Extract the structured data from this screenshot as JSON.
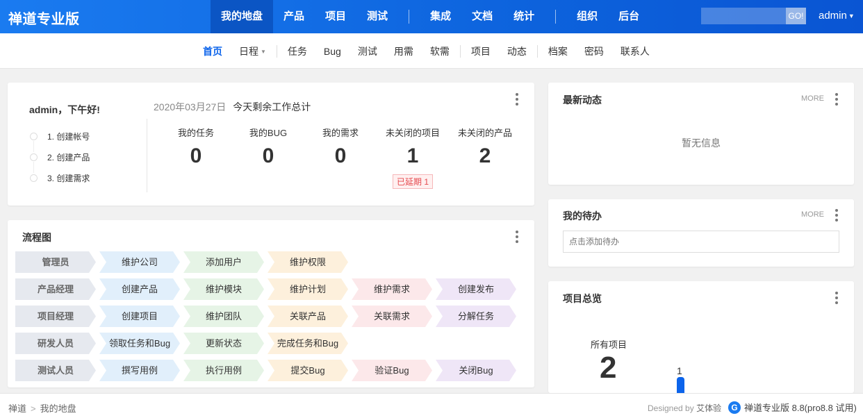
{
  "app": {
    "brand": "禅道专业版"
  },
  "mainnav": {
    "items": [
      "我的地盘",
      "产品",
      "项目",
      "测试",
      "集成",
      "文档",
      "统计",
      "组织",
      "后台"
    ],
    "active": "我的地盘",
    "go_label": "GO!",
    "user": "admin"
  },
  "subnav": {
    "items": [
      "首页",
      "日程",
      "任务",
      "Bug",
      "测试",
      "用需",
      "软需",
      "项目",
      "动态",
      "档案",
      "密码",
      "联系人"
    ],
    "active": "首页"
  },
  "welcome": {
    "greeting": "admin，下午好!",
    "date": "2020年03月27日",
    "summary": "今天剩余工作总计",
    "steps": [
      "1. 创建帐号",
      "2. 创建产品",
      "3. 创建需求"
    ],
    "stats": [
      {
        "label": "我的任务",
        "value": "0"
      },
      {
        "label": "我的BUG",
        "value": "0"
      },
      {
        "label": "我的需求",
        "value": "0"
      },
      {
        "label": "未关闭的项目",
        "value": "1",
        "badge": "已延期 1"
      },
      {
        "label": "未关闭的产品",
        "value": "2"
      }
    ]
  },
  "flow": {
    "title": "流程图",
    "rows": [
      {
        "role": "管理员",
        "steps": [
          "维护公司",
          "添加用户",
          "维护权限"
        ]
      },
      {
        "role": "产品经理",
        "steps": [
          "创建产品",
          "维护模块",
          "维护计划",
          "维护需求",
          "创建发布"
        ]
      },
      {
        "role": "项目经理",
        "steps": [
          "创建项目",
          "维护团队",
          "关联产品",
          "关联需求",
          "分解任务"
        ]
      },
      {
        "role": "研发人员",
        "steps": [
          "领取任务和Bug",
          "更新状态",
          "完成任务和Bug"
        ]
      },
      {
        "role": "测试人员",
        "steps": [
          "撰写用例",
          "执行用例",
          "提交Bug",
          "验证Bug",
          "关闭Bug"
        ]
      }
    ]
  },
  "dynamics": {
    "title": "最新动态",
    "more": "MORE",
    "empty": "暂无信息"
  },
  "todo": {
    "title": "我的待办",
    "more": "MORE",
    "placeholder": "点击添加待办"
  },
  "projects": {
    "title": "项目总览",
    "all_label": "所有项目",
    "all_value": "2",
    "bar_value": "1"
  },
  "footer": {
    "crumbs": [
      "禅道",
      "我的地盘"
    ],
    "designed_by_prefix": "Designed by",
    "designed_by": "艾体验",
    "version": "禅道专业版 8.8(pro8.8 试用)"
  },
  "colors": {
    "topbar": "#0c64eb",
    "accent": "#0c64eb",
    "late": "#e5484d"
  }
}
